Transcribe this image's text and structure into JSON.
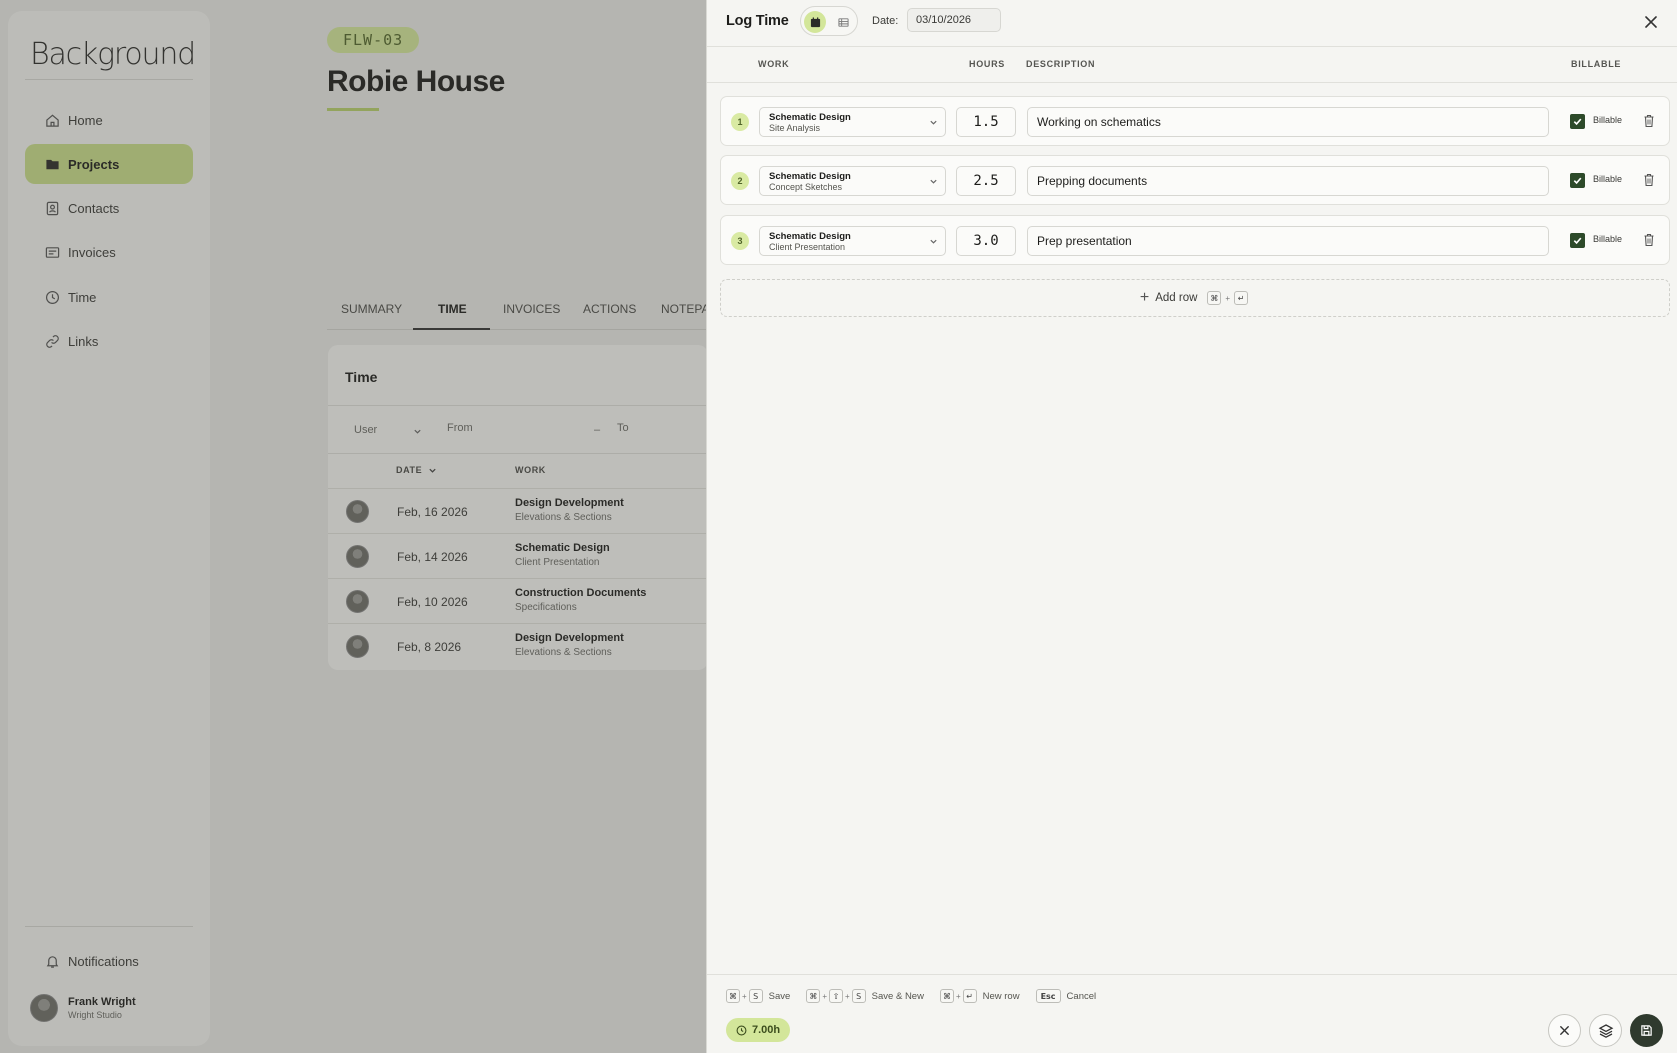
{
  "app": {
    "logo": "Background",
    "nav": [
      {
        "label": "Home"
      },
      {
        "label": "Projects"
      },
      {
        "label": "Contacts"
      },
      {
        "label": "Invoices"
      },
      {
        "label": "Time"
      },
      {
        "label": "Links"
      }
    ],
    "notifications_label": "Notifications",
    "user": {
      "name": "Frank Wright",
      "org": "Wright Studio"
    }
  },
  "project": {
    "code": "FLW-03",
    "title": "Robie House",
    "tabs": [
      "SUMMARY",
      "TIME",
      "INVOICES",
      "ACTIONS",
      "NOTEPA"
    ],
    "active_tab": "TIME"
  },
  "time_card": {
    "title": "Time",
    "filters": {
      "user": "User",
      "from": "From",
      "dash": "–",
      "to": "To"
    },
    "headers": {
      "date": "DATE",
      "work": "WORK"
    },
    "rows": [
      {
        "date": "Feb, 16 2026",
        "work": "Design Development",
        "sub": "Elevations & Sections"
      },
      {
        "date": "Feb, 14 2026",
        "work": "Schematic Design",
        "sub": "Client Presentation"
      },
      {
        "date": "Feb, 10 2026",
        "work": "Construction Documents",
        "sub": "Specifications"
      },
      {
        "date": "Feb, 8 2026",
        "work": "Design Development",
        "sub": "Elevations & Sections"
      }
    ]
  },
  "drawer": {
    "title": "Log Time",
    "date_label": "Date:",
    "date_value": "03/10/2026",
    "columns": {
      "work": "WORK",
      "hours": "HOURS",
      "description": "DESCRIPTION",
      "billable": "BILLABLE"
    },
    "entries": [
      {
        "num": "1",
        "work": "Schematic Design",
        "sub": "Site Analysis",
        "hours": "1.5",
        "description": "Working on schematics",
        "billable": true,
        "billable_label": "Billable"
      },
      {
        "num": "2",
        "work": "Schematic Design",
        "sub": "Concept Sketches",
        "hours": "2.5",
        "description": "Prepping documents",
        "billable": true,
        "billable_label": "Billable"
      },
      {
        "num": "3",
        "work": "Schematic Design",
        "sub": "Client Presentation",
        "hours": "3.0",
        "description": "Prep presentation",
        "billable": true,
        "billable_label": "Billable"
      }
    ],
    "add_row": {
      "label": "Add row",
      "keys": [
        "⌘",
        "+",
        "↵"
      ]
    },
    "shortcuts": [
      {
        "keys": [
          "⌘",
          "S"
        ],
        "label": "Save"
      },
      {
        "keys": [
          "⌘",
          "⇧",
          "S"
        ],
        "label": "Save & New"
      },
      {
        "keys": [
          "⌘",
          "↵"
        ],
        "label": "New row"
      },
      {
        "keys": [
          "Esc"
        ],
        "label": "Cancel"
      }
    ],
    "total": "7.00h",
    "colors": {
      "accent": "#d3e69a",
      "dark": "#2f3a2e"
    }
  }
}
